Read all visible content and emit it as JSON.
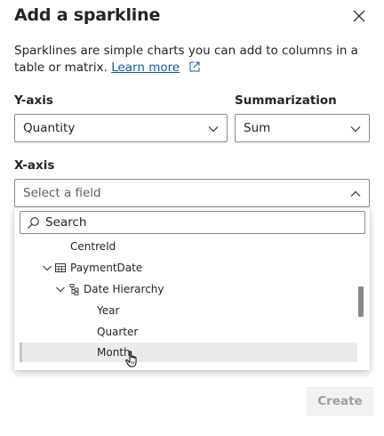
{
  "dialog": {
    "title": "Add a sparkline",
    "description": "Sparklines are simple charts you can add to columns in a table or matrix.",
    "learn_more": "Learn more",
    "create_label": "Create"
  },
  "yaxis": {
    "label": "Y-axis",
    "value": "Quantity"
  },
  "summarization": {
    "label": "Summarization",
    "value": "Sum"
  },
  "xaxis": {
    "label": "X-axis",
    "placeholder": "Select a field"
  },
  "field_search": {
    "placeholder": "Search"
  },
  "tree": {
    "items": [
      {
        "label": "CentreId"
      },
      {
        "label": "PaymentDate"
      },
      {
        "label": "Date Hierarchy"
      },
      {
        "label": "Year"
      },
      {
        "label": "Quarter"
      },
      {
        "label": "Month"
      }
    ]
  },
  "icons": {
    "close": "close-icon",
    "external": "external-link-icon",
    "chevron": "chevron-down-icon",
    "search": "search-icon",
    "table": "table-icon",
    "hierarchy": "hierarchy-icon"
  },
  "colors": {
    "link": "#0f5aa6",
    "border": "#8a8886",
    "disabled_bg": "#f3f2f1",
    "disabled_text": "#a19f9d",
    "hover_row": "#edebe9"
  }
}
